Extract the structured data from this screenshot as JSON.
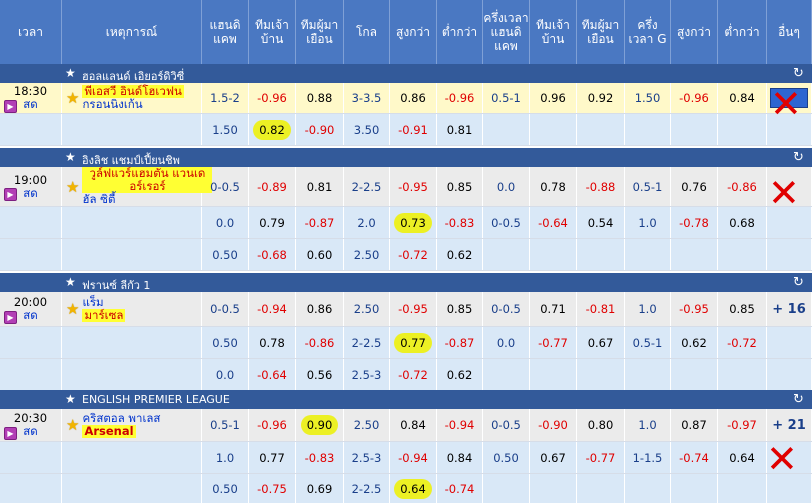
{
  "columns": [
    {
      "key": "time",
      "label": "เวลา"
    },
    {
      "key": "event",
      "label": "เหตุการณ์"
    },
    {
      "key": "hcp",
      "label": "แฮนดิแคพ"
    },
    {
      "key": "home",
      "label": "ทีมเจ้าบ้าน"
    },
    {
      "key": "away",
      "label": "ทีมผู้มาเยือน"
    },
    {
      "key": "goal",
      "label": "โกล"
    },
    {
      "key": "over",
      "label": "สูงกว่า"
    },
    {
      "key": "under",
      "label": "ต่ำกว่า"
    },
    {
      "key": "hthcp",
      "label": "ครึ่งเวลาแฮนดิแคพ"
    },
    {
      "key": "hthome",
      "label": "ทีมเจ้าบ้าน"
    },
    {
      "key": "htaway",
      "label": "ทีมผู้มาเยือน"
    },
    {
      "key": "htgoal",
      "label": "ครึ่งเวลา G"
    },
    {
      "key": "htover",
      "label": "สูงกว่า"
    },
    {
      "key": "htunder",
      "label": "ต่ำกว่า"
    },
    {
      "key": "other",
      "label": "อื่นๆ"
    }
  ],
  "leagues": [
    {
      "name": "ฮอลแลนด์ เอิยอร์ดิวิซี่",
      "time": "18:30",
      "status": "สด",
      "home_team": "พีเอสวี อินด์โฮเวฟน",
      "away_team": "กรอนนิงเก้น",
      "more": "",
      "rows": [
        [
          "1.5-2",
          "-0.96",
          "0.88",
          "3-3.5",
          "0.86",
          "-0.96",
          "0.5-1",
          "0.96",
          "0.92",
          "1.50",
          "-0.96",
          "0.84"
        ],
        [
          "1.50",
          "0.82",
          "-0.90",
          "3.50",
          "-0.91",
          "0.81",
          "",
          "",
          "",
          "",
          "",
          ""
        ]
      ]
    },
    {
      "name": "อิงลิช แชมป์เปี้ยนชิพ",
      "time": "19:00",
      "status": "สด",
      "home_team": "วูล์ฟแวร์แฮมตัน แวนเดอร์เรอร์",
      "away_team": "ฮัล ซิตี้",
      "more": "",
      "rows": [
        [
          "0-0.5",
          "-0.89",
          "0.81",
          "2-2.5",
          "-0.95",
          "0.85",
          "0.0",
          "0.78",
          "-0.88",
          "0.5-1",
          "0.76",
          "-0.86"
        ],
        [
          "0.0",
          "0.79",
          "-0.87",
          "2.0",
          "0.73",
          "-0.83",
          "0-0.5",
          "-0.64",
          "0.54",
          "1.0",
          "-0.78",
          "0.68"
        ],
        [
          "0.50",
          "-0.68",
          "0.60",
          "2.50",
          "-0.72",
          "0.62",
          "",
          "",
          "",
          "",
          "",
          ""
        ]
      ]
    },
    {
      "name": "ฟรานซ์ ลีกัว 1",
      "time": "20:00",
      "status": "สด",
      "home_team": "แร็ม",
      "away_team": "มาร์เซล",
      "more": "+ 16",
      "rows": [
        [
          "0-0.5",
          "-0.94",
          "0.86",
          "2.50",
          "-0.95",
          "0.85",
          "0-0.5",
          "0.71",
          "-0.81",
          "1.0",
          "-0.95",
          "0.85"
        ],
        [
          "0.50",
          "0.78",
          "-0.86",
          "2-2.5",
          "0.77",
          "-0.87",
          "0.0",
          "-0.77",
          "0.67",
          "0.5-1",
          "0.62",
          "-0.72"
        ],
        [
          "0.0",
          "-0.64",
          "0.56",
          "2.5-3",
          "-0.72",
          "0.62",
          "",
          "",
          "",
          "",
          "",
          ""
        ]
      ]
    },
    {
      "name": "ENGLISH PREMIER LEAGUE",
      "time": "20:30",
      "status": "สด",
      "home_team": "คริสตอล พาเลส",
      "away_team": "Arsenal",
      "more": "+ 21",
      "rows": [
        [
          "0.5-1",
          "-0.96",
          "0.90",
          "2.50",
          "0.84",
          "-0.94",
          "0-0.5",
          "-0.90",
          "0.80",
          "1.0",
          "0.87",
          "-0.97"
        ],
        [
          "1.0",
          "0.77",
          "-0.83",
          "2.5-3",
          "-0.94",
          "0.84",
          "0.50",
          "0.67",
          "-0.77",
          "1-1.5",
          "-0.74",
          "0.64"
        ],
        [
          "0.50",
          "-0.75",
          "0.69",
          "2-2.5",
          "0.64",
          "-0.74",
          "",
          "",
          "",
          "",
          "",
          ""
        ]
      ]
    }
  ],
  "icons": {
    "favorite": "star-icon",
    "refresh": "refresh-icon",
    "live_tv": "tv-icon"
  },
  "colors": {
    "header_bg": "#4a78c2",
    "league_bg": "#335a9a",
    "row_blue": "#d9e8f7",
    "row_gray": "#ebebeb",
    "negative": "#e00000",
    "marker": "#ecf024"
  }
}
